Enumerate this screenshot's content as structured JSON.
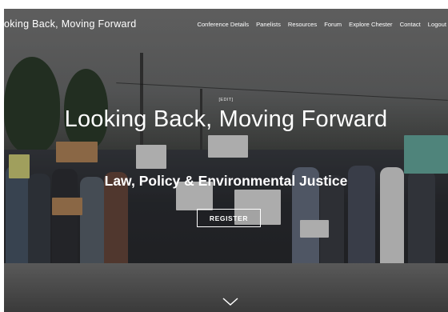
{
  "header": {
    "site_title": "oking Back, Moving Forward",
    "nav": [
      {
        "label": "Conference Details"
      },
      {
        "label": "Panelists"
      },
      {
        "label": "Resources"
      },
      {
        "label": "Forum"
      },
      {
        "label": "Explore Chester"
      },
      {
        "label": "Contact"
      },
      {
        "label": "Logout"
      }
    ]
  },
  "hero": {
    "edit_tag": "[EDIT]",
    "title": "Looking Back, Moving Forward",
    "subtitle": "Law, Policy & Environmental Justice",
    "register_label": "REGISTER"
  },
  "icons": {
    "scroll": "chevron-down-icon"
  }
}
